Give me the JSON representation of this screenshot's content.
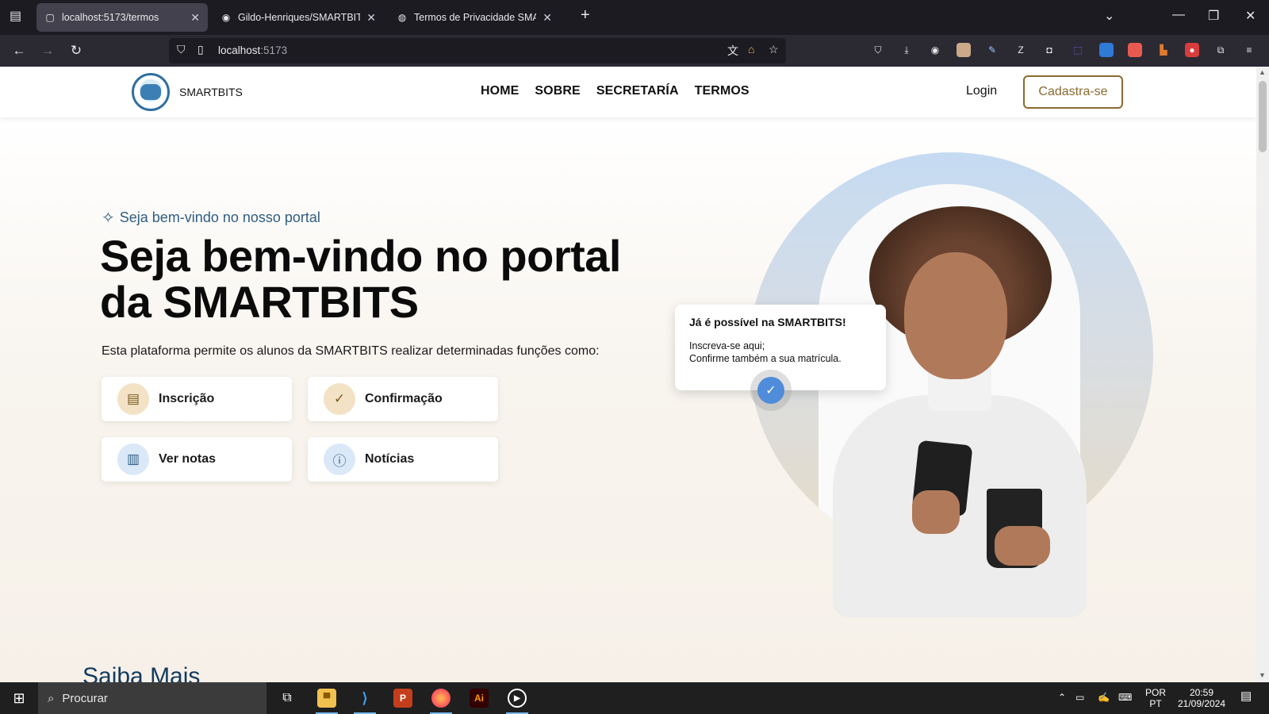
{
  "browser": {
    "tabs": [
      {
        "title": "localhost:5173/termos",
        "active": true
      },
      {
        "title": "Gildo-Henriques/SMARTBITS: P",
        "active": false
      },
      {
        "title": "Termos de Privacidade SMARTB",
        "active": false
      }
    ],
    "url_host": "localhost",
    "url_port": ":5173"
  },
  "site": {
    "brand": "SMARTBITS",
    "nav": [
      "HOME",
      "SOBRE",
      "SECRETARÍA",
      "TERMOS"
    ],
    "login": "Login",
    "signup": "Cadastra-se"
  },
  "hero": {
    "tagline": "Seja bem-vindo no nosso portal",
    "headline": "Seja bem-vindo no portal da SMARTBITS",
    "description": "Esta plataforma permite os alunos da SMARTBITS realizar determinadas funções como:",
    "cards": [
      {
        "label": "Inscrição",
        "icon": "id-card-icon",
        "color": "#f3e2c5"
      },
      {
        "label": "Confirmação",
        "icon": "check-circle-icon",
        "color": "#f3e2c5"
      },
      {
        "label": "Ver notas",
        "icon": "presentation-chart-icon",
        "color": "#dbe8f7"
      },
      {
        "label": "Notícias",
        "icon": "info-icon",
        "color": "#dbe8f7"
      }
    ],
    "popup": {
      "title": "Já é possível na SMARTBITS!",
      "line1": "Inscreva-se aqui;",
      "line2": "Confirme também a sua matrícula."
    }
  },
  "section": {
    "title": "Saiba Mais"
  },
  "taskbar": {
    "search_placeholder": "Procurar",
    "lang_line1": "POR",
    "lang_line2": "PT",
    "time": "20:59",
    "date": "21/09/2024"
  },
  "colors": {
    "accent_gold": "#8a6a2f",
    "accent_blue": "#2f5d83"
  }
}
